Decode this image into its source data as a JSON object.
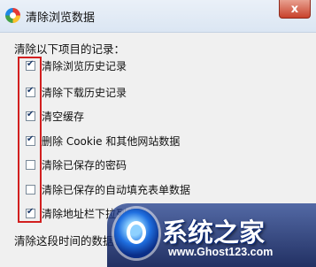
{
  "window": {
    "title": "清除浏览数据",
    "close_label": "x"
  },
  "section_label": "清除以下项目的记录：",
  "options": [
    {
      "label": "清除浏览历史记录",
      "checked": true
    },
    {
      "label": "清除下载历史记录",
      "checked": true
    },
    {
      "label": "清空缓存",
      "checked": true
    },
    {
      "label": "删除 Cookie 和其他网站数据",
      "checked": true
    },
    {
      "label": "清除已保存的密码",
      "checked": false
    },
    {
      "label": "清除已保存的自动填充表单数据",
      "checked": false
    },
    {
      "label": "清除地址栏下拉列表",
      "checked": true
    }
  ],
  "period_label": "清除这段时间的数据：",
  "watermark": {
    "text": "系统之家",
    "url": "www.Ghost123.com"
  },
  "colors": {
    "highlight": "#d21f1f",
    "watermark_bg": "#1e3c8c"
  }
}
